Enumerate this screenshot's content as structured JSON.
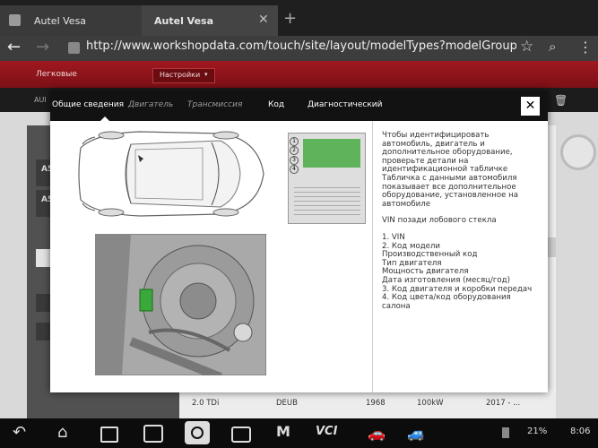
{
  "browser": {
    "tabs": [
      {
        "label": "Autel Vesa"
      },
      {
        "label": "Autel Vesa"
      }
    ],
    "url": "http://www.workshopdata.com/touch/site/layout/modelTypes?modelGroupId=dg"
  },
  "page": {
    "category": "Легковые",
    "settings": "Настройки",
    "truncated_label": "AUI",
    "left_list": [
      "A5",
      "A5"
    ],
    "table_row": [
      "2.0 TDi",
      "DEUB",
      "1968",
      "100kW",
      "2017 - ..."
    ]
  },
  "modal": {
    "tabs": [
      {
        "label": "Общие сведения",
        "active": true
      },
      {
        "label": "Двигатель",
        "active": false
      },
      {
        "label": "Трансмиссия",
        "active": false
      },
      {
        "label": "Код",
        "active": false
      },
      {
        "label": "Диагностический",
        "active": false
      }
    ],
    "close": "✕",
    "intro": "Чтобы идентифицировать автомобиль, двигатель и дополнительное оборудование, проверьте детали на идентификационной табличке",
    "plate_note": "Табличка с данными автомобиля показывает все дополнительное оборудование, установленное на автомобиле",
    "vin_note": "VIN позади лобового стекла",
    "legend": [
      "1. VIN",
      "2. Код модели",
      "Производственный код",
      "Тип двигателя",
      "Мощность двигателя",
      "Дата изготовления (месяц/год)",
      "3. Код двигателя и коробки передач",
      "4. Код цвета/код оборудования салона"
    ],
    "plate_markers": [
      "1",
      "2",
      "3",
      "4"
    ]
  },
  "status": {
    "battery": "21%",
    "time": "8:06",
    "vci": "VCI"
  },
  "colors": {
    "accent_red": "#8b141b",
    "plate_green": "#5fb35a",
    "highlight_green": "#3aa83a"
  }
}
